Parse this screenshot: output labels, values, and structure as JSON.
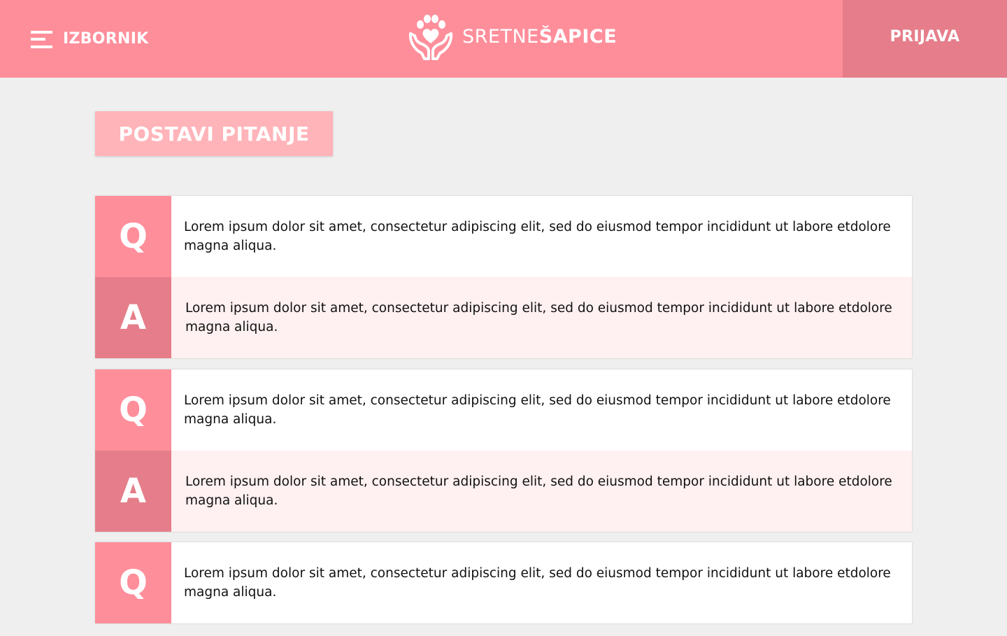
{
  "header": {
    "menu_label": "IZBORNIK",
    "logo_text_light": "SRETNE",
    "logo_text_bold": "ŠAPICE",
    "login_label": "PRIJAVA"
  },
  "ask_button": {
    "label": "POSTAVI PITANJE"
  },
  "qa_items": [
    {
      "q_letter": "Q",
      "question": "Lorem ipsum dolor sit amet, consectetur adipiscing elit, sed do eiusmod tempor incididunt ut labore etdolore magna aliqua.",
      "a_letter": "A",
      "answer": "Lorem ipsum dolor sit amet, consectetur adipiscing elit, sed do eiusmod tempor incididunt ut labore etdolore magna aliqua."
    },
    {
      "q_letter": "Q",
      "question": "Lorem ipsum dolor sit amet, consectetur adipiscing elit, sed do eiusmod tempor incididunt ut labore etdolore magna aliqua.",
      "a_letter": "A",
      "answer": "Lorem ipsum dolor sit amet, consectetur adipiscing elit, sed do eiusmod tempor incididunt ut labore etdolore magna aliqua."
    },
    {
      "q_letter": "Q",
      "question": "Lorem ipsum dolor sit amet, consectetur adipiscing elit, sed do eiusmod tempor incididunt ut labore etdolore magna aliqua."
    }
  ],
  "colors": {
    "header_bg": "#ff8e9b",
    "login_bg": "#e57e8a",
    "ask_button_bg": "#ffb4b9",
    "page_bg": "#efefef",
    "answer_bg": "#fff0f1"
  },
  "icons": {
    "menu": "hamburger-menu-icon",
    "logo": "paw-in-hands-icon"
  }
}
